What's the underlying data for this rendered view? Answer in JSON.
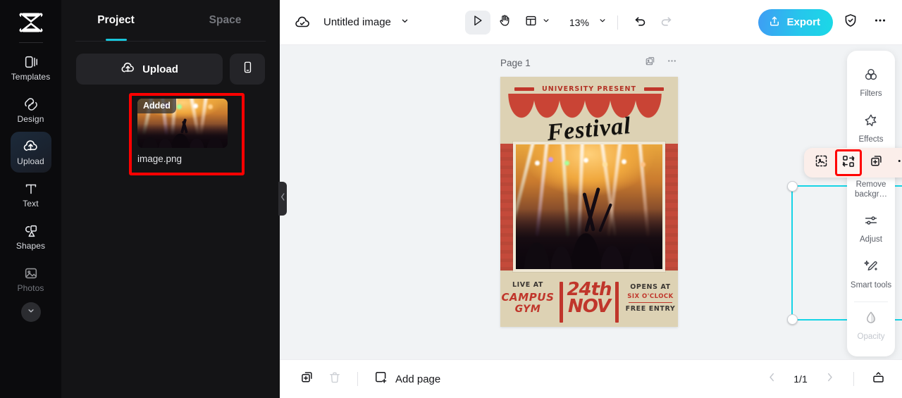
{
  "rail": {
    "logo_icon": "capcut-logo",
    "items": [
      {
        "label": "Templates",
        "icon": "templates-icon",
        "state": "normal"
      },
      {
        "label": "Design",
        "icon": "design-icon",
        "state": "normal"
      },
      {
        "label": "Upload",
        "icon": "upload-cloud-icon",
        "state": "active"
      },
      {
        "label": "Text",
        "icon": "text-icon",
        "state": "normal"
      },
      {
        "label": "Shapes",
        "icon": "shapes-icon",
        "state": "normal"
      },
      {
        "label": "Photos",
        "icon": "photos-icon",
        "state": "dim"
      }
    ],
    "more_icon": "chevron-down-icon"
  },
  "panel": {
    "tabs": [
      {
        "label": "Project",
        "active": true
      },
      {
        "label": "Space",
        "active": false
      }
    ],
    "upload_label": "Upload",
    "upload_icon": "upload-cloud-icon",
    "phone_icon": "mobile-phone-icon",
    "asset": {
      "badge": "Added",
      "filename": "image.png",
      "highlight_color": "#ff0000"
    },
    "collapse_icon": "chevron-left-icon"
  },
  "topbar": {
    "cloud_icon": "cloud-saved-icon",
    "title": "Untitled image",
    "title_caret_icon": "chevron-down-icon",
    "tools": [
      {
        "name": "select-tool",
        "icon": "cursor-arrow-icon",
        "selected": true
      },
      {
        "name": "hand-tool",
        "icon": "hand-icon",
        "selected": false
      },
      {
        "name": "layout-tool",
        "icon": "layout-grid-icon",
        "selected": false
      }
    ],
    "layout_caret_icon": "chevron-down-icon",
    "zoom": "13%",
    "zoom_caret_icon": "chevron-down-icon",
    "undo_icon": "undo-icon",
    "redo_icon": "redo-icon",
    "export_label": "Export",
    "export_icon": "share-up-icon",
    "shield_icon": "shield-check-icon",
    "more_icon": "more-horizontal-icon"
  },
  "canvas": {
    "page_label": "Page 1",
    "page_duplicate_icon": "duplicate-image-icon",
    "page_more_icon": "more-horizontal-icon",
    "selection_color": "#17d4e6",
    "rotate_icon": "rotate-icon",
    "float_toolbar": [
      {
        "name": "crop-button",
        "icon": "crop-dashed-icon",
        "highlighted": false
      },
      {
        "name": "replace-button",
        "icon": "replace-swap-icon",
        "highlighted": true
      },
      {
        "name": "duplicate-button",
        "icon": "duplicate-plus-icon",
        "highlighted": false
      },
      {
        "name": "more-button",
        "icon": "more-horizontal-icon",
        "highlighted": false
      }
    ],
    "poster": {
      "kicker": "UNIVERSITY PRESENT",
      "title": "Festival",
      "left_small": "LIVE AT",
      "left_big": "CAMPUS",
      "left_big2": "GYM",
      "date_top": "24th",
      "date_bottom": "NOV",
      "right_small": "OPENS AT",
      "right_red": "SIX O'CLOCK",
      "right_bottom": "FREE ENTRY"
    }
  },
  "right_panel": {
    "items": [
      {
        "label": "Filters",
        "icon": "filters-circles-icon",
        "disabled": false
      },
      {
        "label": "Effects",
        "icon": "effects-star-icon",
        "disabled": false
      },
      {
        "label": "Remove backgr…",
        "icon": "magic-wand-icon",
        "disabled": false
      },
      {
        "label": "Adjust",
        "icon": "sliders-icon",
        "disabled": false
      },
      {
        "label": "Smart tools",
        "icon": "sparkle-wand-icon",
        "disabled": false
      },
      {
        "label": "Opacity",
        "icon": "opacity-drop-icon",
        "disabled": true
      }
    ]
  },
  "bottombar": {
    "duplicate_icon": "duplicate-plus-icon",
    "delete_icon": "trash-icon",
    "add_page_label": "Add page",
    "add_page_icon": "add-page-icon",
    "prev_icon": "chevron-left-icon",
    "page_indicator": "1/1",
    "next_icon": "chevron-right-icon",
    "expand_icon": "panel-expand-icon"
  }
}
